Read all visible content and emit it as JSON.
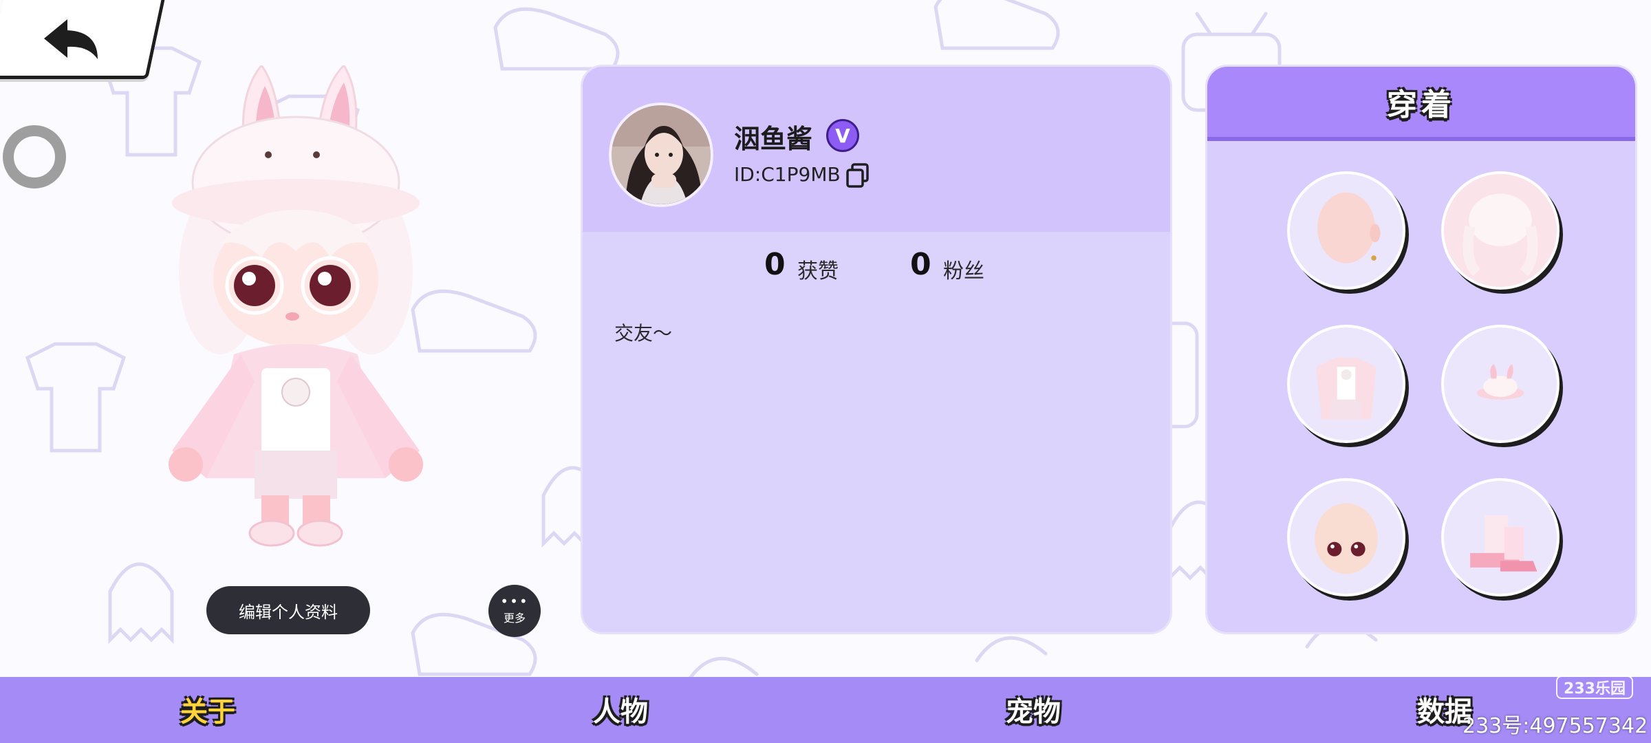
{
  "profile": {
    "username": "洇鱼酱",
    "verified_badge": "V",
    "user_id": "ID:C1P9MB",
    "likes_count": "0",
    "likes_label": "获赞",
    "fans_count": "0",
    "fans_label": "粉丝",
    "bio": "交友～"
  },
  "actions": {
    "edit_profile": "编辑个人资料",
    "more_label": "更多",
    "more_dots": "•••"
  },
  "wearing": {
    "title": "穿着",
    "items": [
      "face",
      "hair",
      "jacket",
      "bunny-hat",
      "head",
      "boots"
    ]
  },
  "nav": {
    "tabs": [
      "关于",
      "人物",
      "宠物",
      "数据"
    ],
    "active_index": 0
  },
  "watermark": {
    "logo": "233乐园",
    "id_text": "233号:497557342"
  },
  "colors": {
    "nav_bar": "#a58bf6",
    "active_tab": "#ffd43b",
    "card_bg": "#dcd3fd",
    "card_header": "#d2c3fd",
    "verified": "#8c5cf4"
  }
}
